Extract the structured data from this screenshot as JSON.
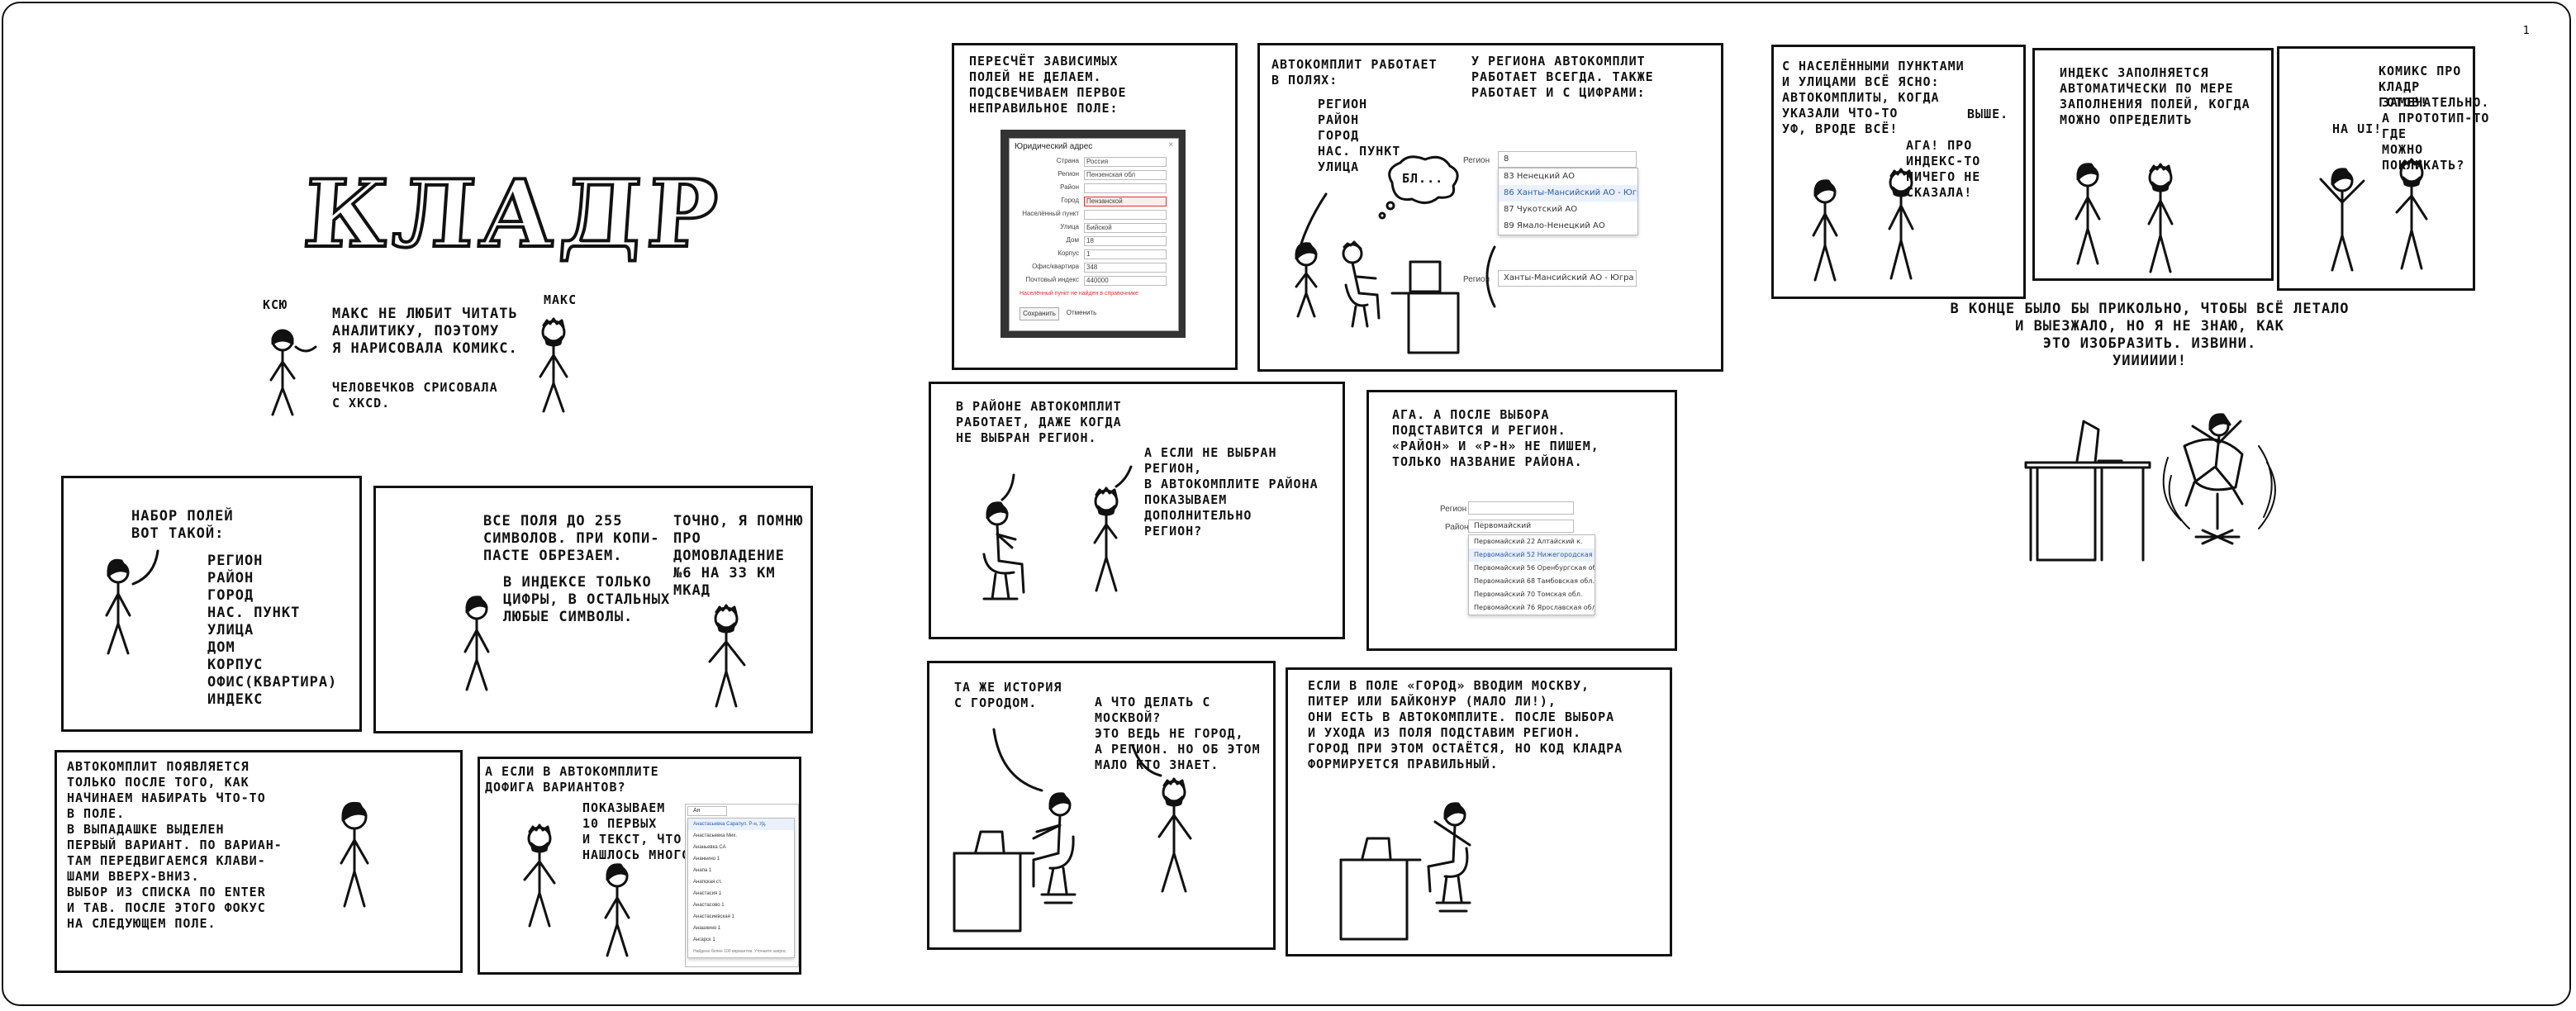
{
  "page_number": "1",
  "title": {
    "word": "КЛАДР"
  },
  "intro": {
    "ksyu_label": "КСЮ",
    "max_label": "МАКС",
    "speech": "МАКС НЕ ЛЮБИТ ЧИТАТЬ\nАНАЛИТИКУ, ПОЭТОМУ\nЯ НАРИСОВАЛА КОМИКС.",
    "note": "ЧЕЛОВЕЧКОВ СРИСОВАЛА\nС XKCD."
  },
  "p1": {
    "text": "НАБОР ПОЛЕЙ\nВОТ ТАКОЙ:",
    "fields": "РЕГИОН\nРАЙОН\nГОРОД\nНАС. ПУНКТ\nУЛИЦА\nДОМ\nКОРПУС\nОФИС(КВАРТИРА)\nИНДЕКС"
  },
  "p2": {
    "a": "ВСЕ ПОЛЯ ДО 255\nСИМВОЛОВ. ПРИ КОПИ-\nПАСТЕ ОБРЕЗАЕМ.",
    "b": "В ИНДЕКСЕ ТОЛЬКО\nЦИФРЫ, В ОСТАЛЬНЫХ\nЛЮБЫЕ СИМВОЛЫ.",
    "c": "ТОЧНО, Я ПОМНЮ\nПРО ДОМОВЛАДЕНИЕ\n№6 НА 33 КМ МКАД"
  },
  "p3": {
    "text": "АВТОКОМПЛИТ ПОЯВЛЯЕТСЯ\nТОЛЬКО ПОСЛЕ ТОГО, КАК\nНАЧИНАЕМ НАБИРАТЬ ЧТО-ТО\nВ ПОЛЕ.\nВ ВЫПАДАШКЕ ВЫДЕЛЕН\nПЕРВЫЙ ВАРИАНТ. ПО ВАРИАН-\nТАМ ПЕРЕДВИГАЕМСЯ КЛАВИ-\nШАМИ ВВЕРХ-ВНИЗ.\nВЫБОР ИЗ СПИСКА ПО ENTER\nИ TAB. ПОСЛЕ ЭТОГО ФОКУС\nНА СЛЕДУЮЩЕМ ПОЛЕ."
  },
  "p4": {
    "a": "А ЕСЛИ В АВТОКОМПЛИТЕ\nДОФИГА ВАРИАНТОВ?",
    "b": "ПОКАЗЫВАЕМ\n10 ПЕРВЫХ\nИ ТЕКСТ, ЧТО\nНАШЛОСЬ МНОГО"
  },
  "p5": {
    "text": "ПЕРЕСЧЁТ ЗАВИСИМЫХ\nПОЛЕЙ НЕ ДЕЛАЕМ.\nПОДСВЕЧИВАЕМ ПЕРВОЕ\nНЕПРАВИЛЬНОЕ ПОЛЕ:",
    "dialog_title": "Юридический адрес",
    "rows": [
      {
        "label": "Страна",
        "value": "Россия",
        "error": false
      },
      {
        "label": "Регион",
        "value": "Пензенская обл",
        "error": false
      },
      {
        "label": "Район",
        "value": "",
        "error": false
      },
      {
        "label": "Город",
        "value": "Пензанской",
        "error": true
      },
      {
        "label": "Населённый пункт",
        "value": "",
        "error": false
      },
      {
        "label": "Улица",
        "value": "Бийской",
        "error": false
      },
      {
        "label": "Дом",
        "value": "18",
        "error": false
      },
      {
        "label": "Корпус",
        "value": "1",
        "error": false
      },
      {
        "label": "Офис/квартира",
        "value": "348",
        "error": false
      },
      {
        "label": "Почтовый индекс",
        "value": "440000",
        "error": false
      }
    ],
    "error_text": "Населённый пункт не найден в справочнике",
    "save": "Сохранить",
    "cancel": "Отменить"
  },
  "p6": {
    "a": "АВТОКОМПЛИТ РАБОТАЕТ\nВ ПОЛЯХ:",
    "fields": "РЕГИОН\nРАЙОН\nГОРОД\nНАС. ПУНКТ\nУЛИЦА",
    "bubble": "БЛ...",
    "b": "У РЕГИОНА АВТОКОМПЛИТ\nРАБОТАЕТ ВСЕГДА. ТАКЖЕ\nРАБОТАЕТ И С ЦИФРАМИ:",
    "region_label": "Регион",
    "region_input": "8",
    "options": [
      "83 Ненецкий АО",
      "86 Ханты-Мансийский АО - Югра",
      "87 Чукотский АО",
      "89 Ямало-Ненецкий АО"
    ],
    "result_label": "Регион",
    "result_value": "Ханты-Мансийский АО - Югра"
  },
  "p7": {
    "a": "В РАЙОНЕ АВТОКОМПЛИТ\nРАБОТАЕТ, ДАЖЕ КОГДА\nНЕ ВЫБРАН РЕГИОН.",
    "b": "А ЕСЛИ НЕ ВЫБРАН РЕГИОН,\nВ АВТОКОМПЛИТЕ РАЙОНА\nПОКАЗЫВАЕМ ДОПОЛНИТЕЛЬНО\nРЕГИОН?"
  },
  "p8": {
    "text": "АГА. А ПОСЛЕ ВЫБОРА\nПОДСТАВИТСЯ И РЕГИОН.\n«РАЙОН» И «Р-Н» НЕ ПИШЕМ,\nТОЛЬКО НАЗВАНИЕ РАЙОНА.",
    "region_label": "Регион",
    "rayon_label": "Район",
    "rayon_input": "Первомайский",
    "options": [
      "Первомайский 22 Алтайский к.",
      "Первомайский 52 Нижегородская обл.",
      "Первомайский 56 Оренбургская обл.",
      "Первомайский 68 Тамбовская обл.",
      "Первомайский 70 Томская обл.",
      "Первомайский 76 Ярославская обл."
    ]
  },
  "p9": {
    "a": "ТА ЖЕ ИСТОРИЯ\nС ГОРОДОМ.",
    "b": "А ЧТО ДЕЛАТЬ С МОСКВОЙ?\nЭТО ВЕДЬ НЕ ГОРОД,\nА РЕГИОН. НО ОБ ЭТОМ\nМАЛО КТО ЗНАЕТ."
  },
  "p10": {
    "text": "ЕСЛИ В ПОЛЕ «ГОРОД» ВВОДИМ МОСКВУ,\nПИТЕР ИЛИ БАЙКОНУР (МАЛО ЛИ!),\nОНИ ЕСТЬ В АВТОКОМПЛИТЕ. ПОСЛЕ ВЫБОРА\nИ УХОДА ИЗ ПОЛЯ ПОДСТАВИМ РЕГИОН.\nГОРОД ПРИ ЭТОМ ОСТАЁТСЯ, НО КОД КЛАДРА\nФОРМИРУЕТСЯ ПРАВИЛЬНЫЙ."
  },
  "p11": {
    "a": "С НАСЕЛЁННЫМИ ПУНКТАМИ\nИ УЛИЦАМИ ВСЁ ЯСНО:\nАВТОКОМПЛИТЫ, КОГДА\nУКАЗАЛИ ЧТО-ТО\nУФ, ВРОДЕ ВСЁ!",
    "b": "АГА! ПРО ИНДЕКС-ТО\nНИЧЕГО НЕ СКАЗАЛА!",
    "b_extra": "ВЫШЕ."
  },
  "p12": {
    "text": "ИНДЕКС ЗАПОЛНЯЕТСЯ\nАВТОМАТИЧЕСКИ ПО МЕРЕ\nЗАПОЛНЕНИЯ ПОЛЕЙ, КОГДА\nМОЖНО ОПРЕДЕЛИТЬ"
  },
  "p13": {
    "a": "КОМИКС ПРО\nКЛАДР ГОТОВ!",
    "b": "НА UI!",
    "c": "ЗАМЕЧАТЕЛЬНО.\nА ПРОТОТИП-ТО ГДЕ\nМОЖНО ПОКЛИКАТЬ?"
  },
  "outro": {
    "text": "В КОНЦЕ БЫЛО БЫ ПРИКОЛЬНО, ЧТОБЫ ВСЁ ЛЕТАЛО\nИ ВЫЕЗЖАЛО, НО Я НЕ ЗНАЮ, КАК\nЭТО ИЗОБРАЗИТЬ. ИЗВИНИ.\nУИИИИИИ!"
  },
  "p4_dropdown": [
    "Ан",
    "Анастасьевка Сарапул. Р-н, Уд.",
    "Анастасьевка Мих.",
    "Ананьевка СА",
    "Ананьино 1",
    "Анапа 1",
    "Анапская ст.",
    "Анастасия 1",
    "Анастасово 1",
    "Анастасиевская 1",
    "Анашкино 1",
    "Ангарск 1",
    "Найдено более 100 вариантов. Уточните запрос."
  ]
}
